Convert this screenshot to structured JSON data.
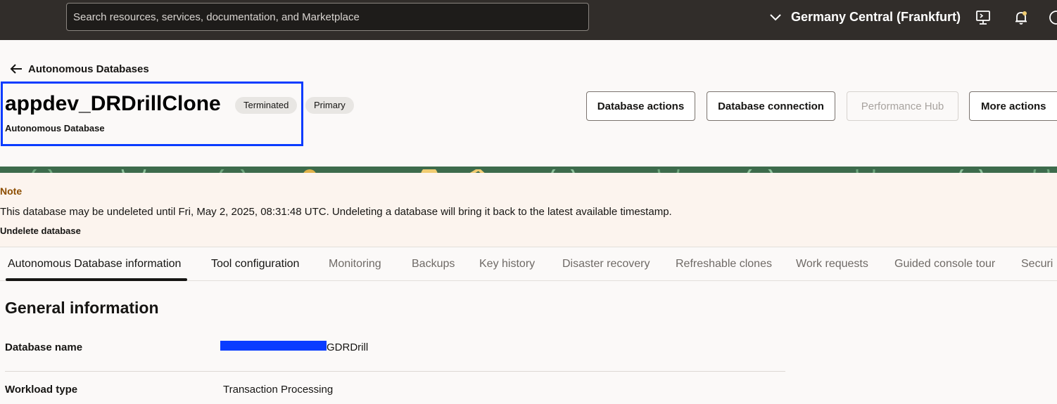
{
  "topbar": {
    "search_placeholder": "Search resources, services, documentation, and Marketplace",
    "region": "Germany Central (Frankfurt)"
  },
  "header": {
    "back_label": "Autonomous Databases",
    "title": "appdev_DRDrillClone",
    "badges": [
      "Terminated",
      "Primary"
    ],
    "subtitle": "Autonomous Database",
    "buttons": {
      "database_actions": "Database actions",
      "database_connection": "Database connection",
      "performance_hub": "Performance Hub",
      "more_actions": "More actions"
    }
  },
  "note": {
    "title": "Note",
    "text": "This database may be undeleted until Fri, May 2, 2025, 08:31:48 UTC. Undeleting a database will bring it back to the latest available timestamp.",
    "link": "Undelete database"
  },
  "tabs": [
    "Autonomous Database information",
    "Tool configuration",
    "Monitoring",
    "Backups",
    "Key history",
    "Disaster recovery",
    "Refreshable clones",
    "Work requests",
    "Guided console tour",
    "Securi"
  ],
  "general": {
    "title": "General information",
    "rows": [
      {
        "label": "Database name",
        "value": "GDRDrill"
      },
      {
        "label": "Workload type",
        "value": "Transaction Processing"
      }
    ]
  },
  "colors": {
    "topbar": "#312d2a",
    "highlight": "#0a3cff",
    "note_title": "#8c4d00"
  }
}
